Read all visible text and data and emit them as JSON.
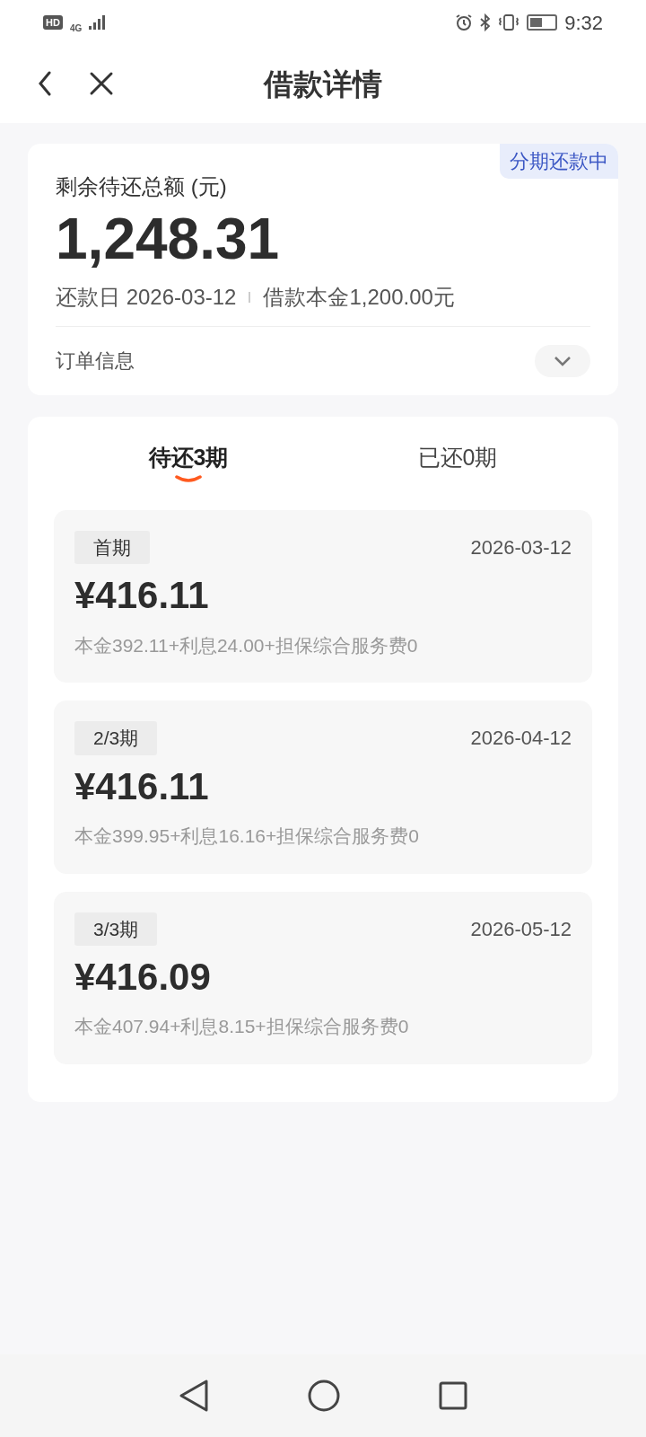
{
  "status_bar": {
    "hd_badge": "HD",
    "network": "4G",
    "time": "9:32"
  },
  "header": {
    "title": "借款详情"
  },
  "summary": {
    "badge": "分期还款中",
    "label": "剩余待还总额 (元)",
    "amount": "1,248.31",
    "due_date": "还款日 2026-03-12",
    "principal": "借款本金1,200.00元",
    "order_info": "订单信息",
    "expanded": false
  },
  "tabs": [
    {
      "label": "待还3期",
      "selected": true
    },
    {
      "label": "已还0期",
      "selected": false
    }
  ],
  "installments": [
    {
      "period": "首期",
      "date": "2026-03-12",
      "amount": "¥416.11",
      "breakdown": "本金392.11+利息24.00+担保综合服务费0"
    },
    {
      "period": "2/3期",
      "date": "2026-04-12",
      "amount": "¥416.11",
      "breakdown": "本金399.95+利息16.16+担保综合服务费0"
    },
    {
      "period": "3/3期",
      "date": "2026-05-12",
      "amount": "¥416.09",
      "breakdown": "本金407.94+利息8.15+担保综合服务费0"
    }
  ]
}
